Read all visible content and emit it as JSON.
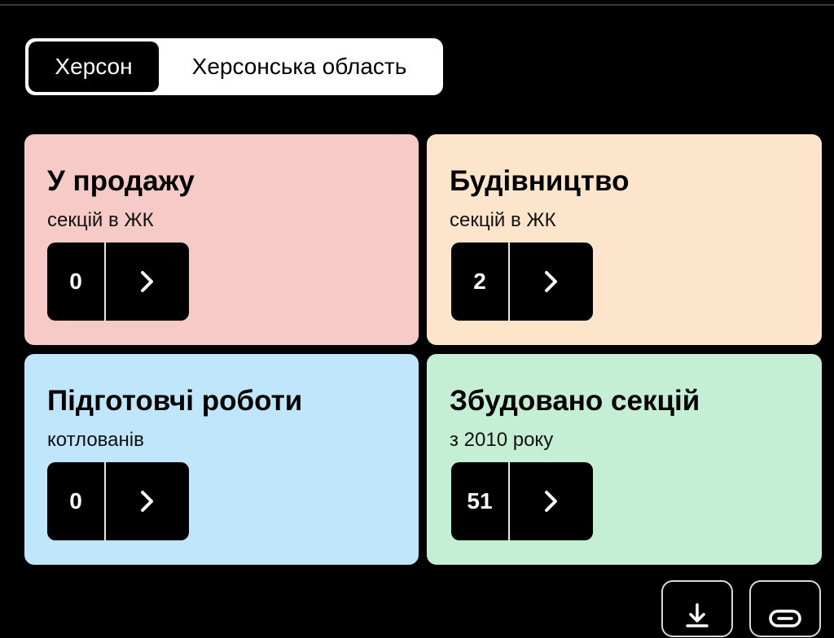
{
  "region_toggle": {
    "active_label": "Херсон",
    "inactive_label": "Херсонська область"
  },
  "cards": [
    {
      "title": "У продажу",
      "subtitle": "секцій в ЖК",
      "value": "0",
      "color": "#f6cac6"
    },
    {
      "title": "Будівництво",
      "subtitle": "секцій в ЖК",
      "value": "2",
      "color": "#fde5cb"
    },
    {
      "title": "Підготовчі роботи",
      "subtitle": "котлованів",
      "value": "0",
      "color": "#bfe6fb"
    },
    {
      "title": "Збудовано секцій",
      "subtitle": "з 2010 року",
      "value": "51",
      "color": "#c4efd5"
    }
  ],
  "icons": {
    "card_arrow": "chevron-right-icon",
    "download": "download-icon",
    "link": "link-icon"
  }
}
